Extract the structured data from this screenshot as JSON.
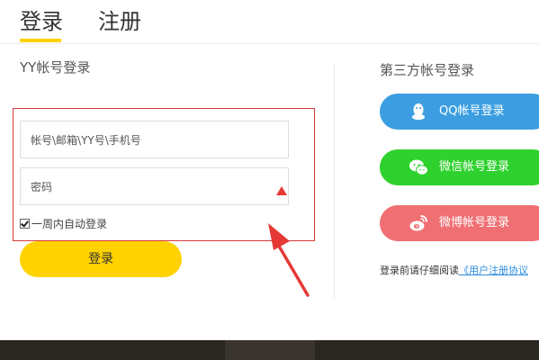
{
  "tabs": {
    "login": "登录",
    "register": "注册"
  },
  "yy_login": {
    "title": "YY帐号登录",
    "account_placeholder": "帐号\\邮箱\\YY号\\手机号",
    "password_placeholder": "密码",
    "remember_label": "一周内自动登录",
    "remember_checked": true,
    "login_button": "登录"
  },
  "third_party": {
    "title": "第三方帐号登录",
    "buttons": [
      {
        "label": "QQ帐号登录",
        "icon": "qq-penguin-icon",
        "color": "#3c9ee1"
      },
      {
        "label": "微信帐号登录",
        "icon": "wechat-icon",
        "color": "#2ed12d"
      },
      {
        "label": "微博帐号登录",
        "icon": "weibo-icon",
        "color": "#ef6f73"
      }
    ],
    "agreement_prefix": "登录前请仔细阅读",
    "agreement_link": "《用户注册协议"
  },
  "colors": {
    "accent": "#ffd200",
    "annotation_red": "#d63a3a"
  }
}
